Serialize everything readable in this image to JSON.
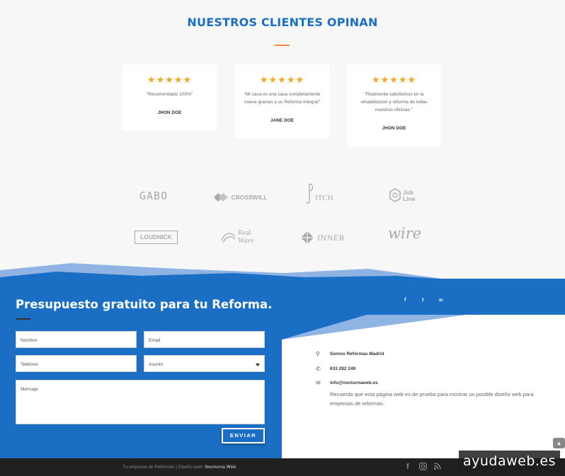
{
  "testimonials": {
    "title": "NUESTROS CLIENTES OPINAN",
    "cards": [
      {
        "stars": "★★★★★",
        "quote": "\"Recomendado 100%\"",
        "author": "JHON DOE"
      },
      {
        "stars": "★★★★★",
        "quote": "\"Mi casa es una casa completamente nueva gracias a su Reforma Integral\"",
        "author": "JANE DOE"
      },
      {
        "stars": "★★★★★",
        "quote": "\"Realmente satisfechos en la rehabilitación y reforma de todas nuestras oficinas.\"",
        "author": "JHON DOE"
      }
    ]
  },
  "logos": {
    "row1": [
      "GABO",
      "CROSSWILL",
      "ITCH",
      "Job",
      "Line"
    ],
    "row2": [
      "LOUDNICK",
      "Real",
      "Wave",
      "INNER",
      "wire"
    ]
  },
  "form": {
    "title": "Presupuesto gratuito para tu Reforma.",
    "name_placeholder": "Nombre",
    "email_placeholder": "Email",
    "phone_placeholder": "Teléfono",
    "subject_value": "Asunto",
    "message_placeholder": "Mensaje",
    "send_label": "ENVIAR"
  },
  "social_top": {
    "facebook": "f",
    "twitter": "t",
    "linkedin": "in"
  },
  "contact": {
    "company": "Somos Reformas Madrid",
    "phone": "633 282 249",
    "email": "info@nocturnaweb.es",
    "description": "Recuerda que esta página web es de prueba para mostrar un posible diseño web para empresas de reformas."
  },
  "footer": {
    "credits_prefix": "Tu empresa de Reformas | Diseño web:",
    "credits_brand": "Nocturna Web"
  },
  "watermark": "ayudaweb.es",
  "colors": {
    "brand_blue": "#1a6fc4",
    "accent_orange": "#f5883a",
    "star": "#f5a623"
  }
}
